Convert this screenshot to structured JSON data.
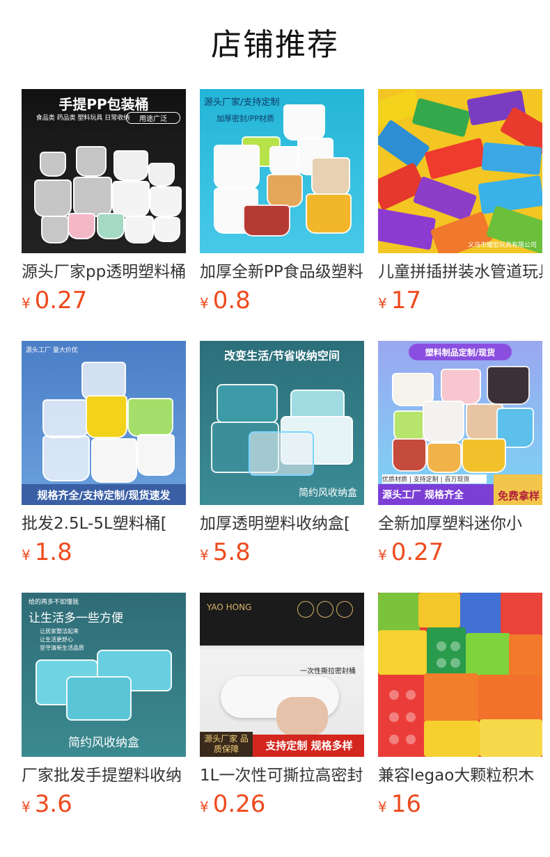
{
  "header": {
    "title": "店铺推荐"
  },
  "products": [
    {
      "title": "源头厂家pp透明塑料桶",
      "currency": "¥",
      "price": "0.27",
      "image_text": [
        "手提PP包装桶",
        "食品类 药品类 塑料玩具 日常收纳",
        "用途广泛"
      ]
    },
    {
      "title": "加厚全新PP食品级塑料",
      "currency": "¥",
      "price": "0.8",
      "image_text": [
        "源头厂家/支持定制",
        "加厚密封/PP材质"
      ]
    },
    {
      "title": "儿童拼插拼装水管道玩具",
      "currency": "¥",
      "price": "17",
      "image_text": [
        "义乌市耀宏玩具有限公司"
      ]
    },
    {
      "title": "批发2.5L-5L塑料桶[",
      "currency": "¥",
      "price": "1.8",
      "image_text": [
        "源头工厂 量大价优",
        "规格齐全/支持定制/现货速发"
      ]
    },
    {
      "title": "加厚透明塑料收纳盒[",
      "currency": "¥",
      "price": "5.8",
      "image_text": [
        "改变生活/节省收纳空间",
        "简约风收纳盒"
      ]
    },
    {
      "title": "全新加厚塑料迷你小",
      "currency": "¥",
      "price": "0.27",
      "image_text": [
        "塑料制品定制/现货",
        "优质材质 | 支持定制 | 百万现货",
        "源头工厂 规格齐全",
        "免费拿样"
      ]
    },
    {
      "title": "厂家批发手提塑料收纳",
      "currency": "¥",
      "price": "3.6",
      "image_text": [
        "给的再多不如懂我",
        "让生活多一些方便",
        "让居家整洁起来",
        "让生活更舒心",
        "坚守清新生活品质",
        "简约风收纳盒"
      ]
    },
    {
      "title": "1L一次性可撕拉高密封",
      "currency": "¥",
      "price": "0.26",
      "image_text": [
        "YAO HONG",
        "一次性撕拉密封桶",
        "源头厂家 品质保障",
        "支持定制 规格多样"
      ]
    },
    {
      "title": "兼容legao大颗粒积木",
      "currency": "¥",
      "price": "16",
      "image_text": []
    }
  ],
  "colors": {
    "price": "#ee4a1e",
    "title": "#333333"
  }
}
